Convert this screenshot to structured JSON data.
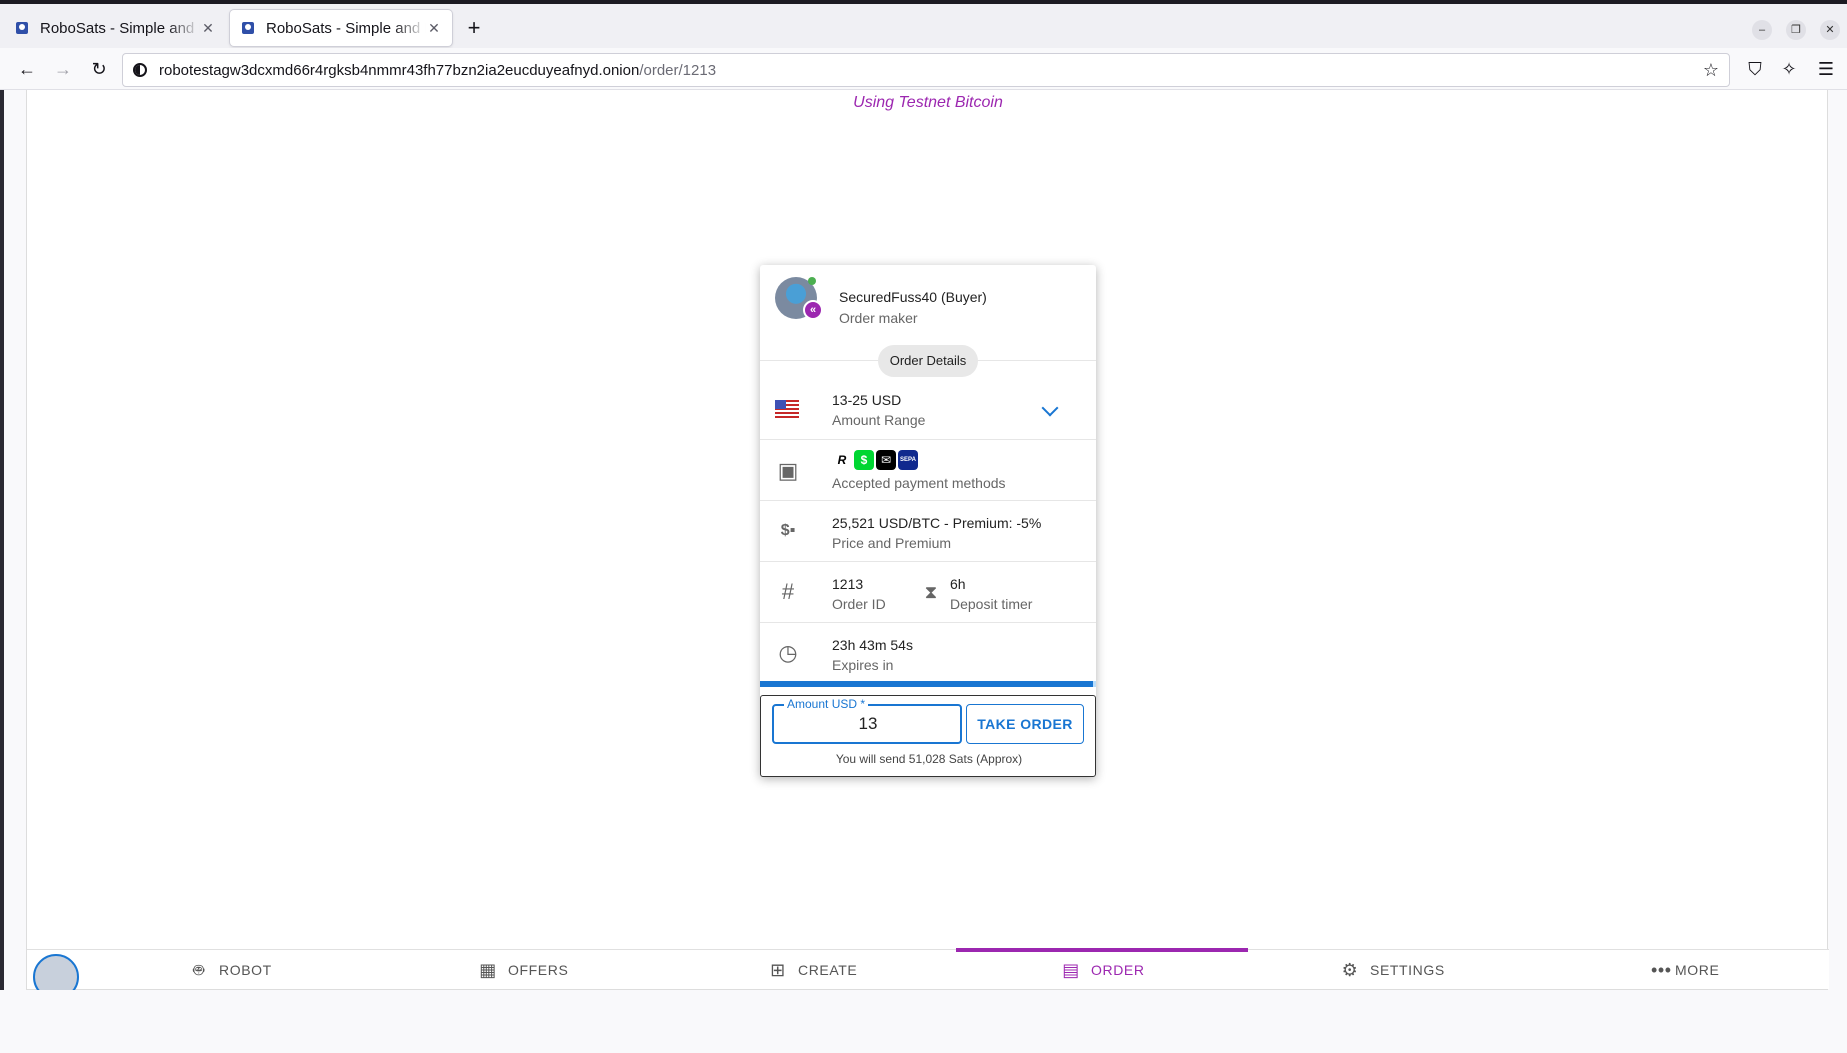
{
  "browser": {
    "tabs": [
      {
        "title": "RoboSats - Simple and Private Bitcoin Exchange",
        "active": false
      },
      {
        "title": "RoboSats - Simple and Private Bitcoin Exchange",
        "active": true
      }
    ],
    "url_host": "robotestagw3dcxmd66r4rgksb4nmmr43fh77bzn2ia2eucduyeafnyd.onion",
    "url_path": "/order/1213"
  },
  "page": {
    "banner": "Using Testnet Bitcoin"
  },
  "order": {
    "maker_name": "SecuredFuss40 (Buyer)",
    "maker_role": "Order maker",
    "details_chip": "Order Details",
    "amount_primary": "13-25 USD",
    "amount_secondary": "Amount Range",
    "payment_secondary": "Accepted payment methods",
    "payment_methods": [
      {
        "icon": "revolut-icon",
        "glyph": "R",
        "bg": "#ffffff",
        "fg": "#000000"
      },
      {
        "icon": "cashapp-icon",
        "glyph": "$",
        "bg": "#00d632",
        "fg": "#ffffff"
      },
      {
        "icon": "paypal-icon",
        "glyph": "✉",
        "bg": "#000000",
        "fg": "#ffffff"
      },
      {
        "icon": "sepa-icon",
        "glyph": "SEPA",
        "bg": "#10298e",
        "fg": "#ffffff"
      }
    ],
    "price_primary": "25,521 USD/BTC - Premium: -5%",
    "price_secondary": "Price and Premium",
    "order_id": "1213",
    "order_id_label": "Order ID",
    "deposit_timer": "6h",
    "deposit_timer_label": "Deposit timer",
    "expires": "23h 43m 54s",
    "expires_label": "Expires in",
    "expiry_progress_fraction": 0.99,
    "amount_label": "Amount USD *",
    "amount_value": "13",
    "take_button": "TAKE ORDER",
    "send_note": "You will send 51,028 Sats (Approx)"
  },
  "bottom_nav": {
    "items": [
      {
        "label": "ROBOT",
        "icon": "robot-icon"
      },
      {
        "label": "OFFERS",
        "icon": "storefront-icon"
      },
      {
        "label": "CREATE",
        "icon": "add-box-icon"
      },
      {
        "label": "ORDER",
        "icon": "assignment-icon",
        "active": true
      },
      {
        "label": "SETTINGS",
        "icon": "settings-icon"
      },
      {
        "label": "MORE",
        "icon": "more-horiz-icon"
      }
    ]
  },
  "colors": {
    "accent": "#9c27b0",
    "primary": "#1976d2"
  }
}
